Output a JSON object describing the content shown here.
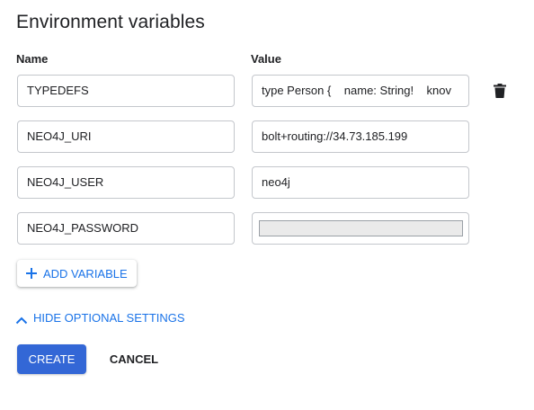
{
  "title": "Environment variables",
  "columns": {
    "name": "Name",
    "value": "Value"
  },
  "variables": [
    {
      "name": "TYPEDEFS",
      "value": "type Person {    name: String!    knov"
    },
    {
      "name": "NEO4J_URI",
      "value": "bolt+routing://34.73.185.199"
    },
    {
      "name": "NEO4J_USER",
      "value": "neo4j"
    },
    {
      "name": "NEO4J_PASSWORD",
      "value": ""
    }
  ],
  "icons": {
    "delete": "trash-icon",
    "add": "plus-icon",
    "collapse": "chevron-up-icon"
  },
  "actions": {
    "add_variable": "ADD VARIABLE",
    "hide_optional": "HIDE OPTIONAL SETTINGS",
    "create": "CREATE",
    "cancel": "CANCEL"
  },
  "colors": {
    "primary": "#3367d6",
    "link": "#1a73e8",
    "border": "#c4c7cc"
  }
}
